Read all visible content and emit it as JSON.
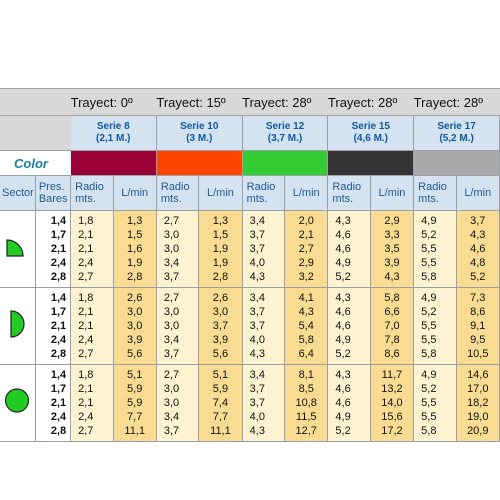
{
  "trayect": [
    "Trayect: 0º",
    "Trayect: 15º",
    "Trayect: 28º",
    "Trayect: 28º",
    "Trayect: 28º"
  ],
  "series": [
    {
      "name": "Serie 8",
      "sub": "(2,1 M.)",
      "color": "#990033"
    },
    {
      "name": "Serie 10",
      "sub": "(3 M.)",
      "color": "#ff4500"
    },
    {
      "name": "Serie 12",
      "sub": "(3,7 M.)",
      "color": "#33cc33"
    },
    {
      "name": "Serie 15",
      "sub": "(4,6 M.)",
      "color": "#333333"
    },
    {
      "name": "Serie 17",
      "sub": "(5,2 M.)",
      "color": "#a9a9a9"
    }
  ],
  "color_label": "Color",
  "headers": {
    "sector": "Sector",
    "pres_1": "Pres.",
    "pres_2": "Bares",
    "radio_1": "Radio",
    "radio_2": "mts.",
    "lmin": "L/min"
  },
  "sector_icons": [
    "quarter-circle-icon",
    "half-circle-icon",
    "full-circle-icon"
  ],
  "sector_color": "#22cc22",
  "groups": [
    {
      "pressures": [
        "1,4",
        "1,7",
        "2,1",
        "2,4",
        "2,8"
      ],
      "radio": [
        [
          "1,8",
          "2,1",
          "2,1",
          "2,4",
          "2,7"
        ],
        [
          "2,7",
          "3,0",
          "3,0",
          "3,4",
          "3,7"
        ],
        [
          "3,4",
          "3,7",
          "3,7",
          "4,0",
          "4,3"
        ],
        [
          "4,3",
          "4,6",
          "4,6",
          "4,9",
          "5,2"
        ],
        [
          "4,9",
          "5,2",
          "5,5",
          "5,5",
          "5,8"
        ]
      ],
      "lmin": [
        [
          "1,3",
          "1,5",
          "1,6",
          "1,9",
          "2,8"
        ],
        [
          "1,3",
          "1,5",
          "1,9",
          "1,9",
          "2,8"
        ],
        [
          "2,0",
          "2,1",
          "2,7",
          "2,9",
          "3,2"
        ],
        [
          "2,9",
          "3,3",
          "3,5",
          "3,9",
          "4,3"
        ],
        [
          "3,7",
          "4,3",
          "4,6",
          "4,8",
          "5,2"
        ]
      ]
    },
    {
      "pressures": [
        "1,4",
        "1,7",
        "2,1",
        "2,4",
        "2,8"
      ],
      "radio": [
        [
          "1,8",
          "2,1",
          "2,1",
          "2,4",
          "2,7"
        ],
        [
          "2,7",
          "3,0",
          "3,0",
          "3,4",
          "3,7"
        ],
        [
          "3,4",
          "3,7",
          "3,7",
          "4,0",
          "4,3"
        ],
        [
          "4,3",
          "4,6",
          "4,6",
          "4,9",
          "5,2"
        ],
        [
          "4,9",
          "5,2",
          "5,5",
          "5,5",
          "5,8"
        ]
      ],
      "lmin": [
        [
          "2,6",
          "3,0",
          "3,0",
          "3,9",
          "5,6"
        ],
        [
          "2,6",
          "3,0",
          "3,7",
          "3,9",
          "5,6"
        ],
        [
          "4,1",
          "4,3",
          "5,4",
          "5,8",
          "6,4"
        ],
        [
          "5,8",
          "6,6",
          "7,0",
          "7,8",
          "8,6"
        ],
        [
          "7,3",
          "8,6",
          "9,1",
          "9,5",
          "10,5"
        ]
      ]
    },
    {
      "pressures": [
        "1,4",
        "1,7",
        "2,1",
        "2,4",
        "2,8"
      ],
      "radio": [
        [
          "1,8",
          "2,1",
          "2,1",
          "2,4",
          "2,7"
        ],
        [
          "2,7",
          "3,0",
          "3,0",
          "3,4",
          "3,7"
        ],
        [
          "3,4",
          "3,7",
          "3,7",
          "4,0",
          "4,3"
        ],
        [
          "4,3",
          "4,6",
          "4,6",
          "4,9",
          "5,2"
        ],
        [
          "4,9",
          "5,2",
          "5,5",
          "5,5",
          "5,8"
        ]
      ],
      "lmin": [
        [
          "5,1",
          "5,9",
          "5,9",
          "7,7",
          "11,1"
        ],
        [
          "5,1",
          "5,9",
          "7,4",
          "7,7",
          "11,1"
        ],
        [
          "8,1",
          "8,5",
          "10,8",
          "11,5",
          "12,7"
        ],
        [
          "11,7",
          "13,2",
          "14,0",
          "15,6",
          "17,2"
        ],
        [
          "14,6",
          "17,0",
          "18,2",
          "19,0",
          "20,9"
        ]
      ]
    }
  ]
}
